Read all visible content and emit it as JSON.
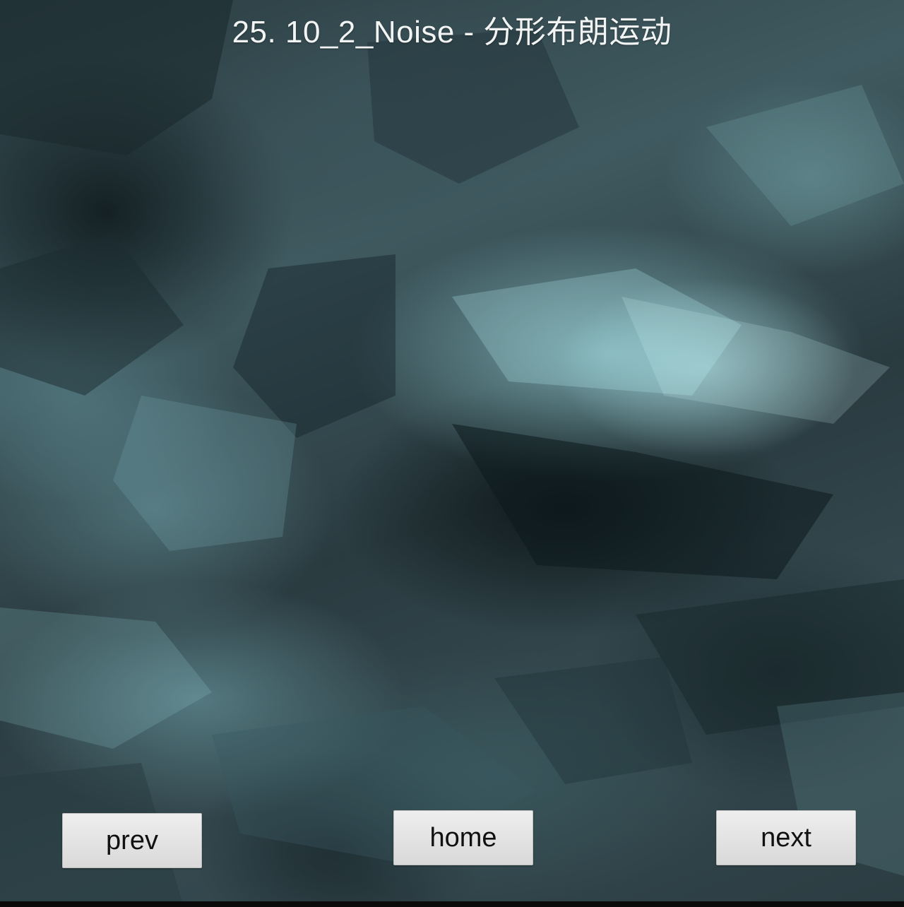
{
  "page": {
    "title": "25.  10_2_Noise - 分形布朗运动"
  },
  "nav": {
    "prev_label": "prev",
    "home_label": "home",
    "next_label": "next"
  },
  "colors": {
    "background_dark": "#1c2a2e",
    "cloud_light": "#aaebf0",
    "title_text": "#f2f4f4",
    "button_face": "#e4e4e4",
    "button_text": "#111111"
  }
}
